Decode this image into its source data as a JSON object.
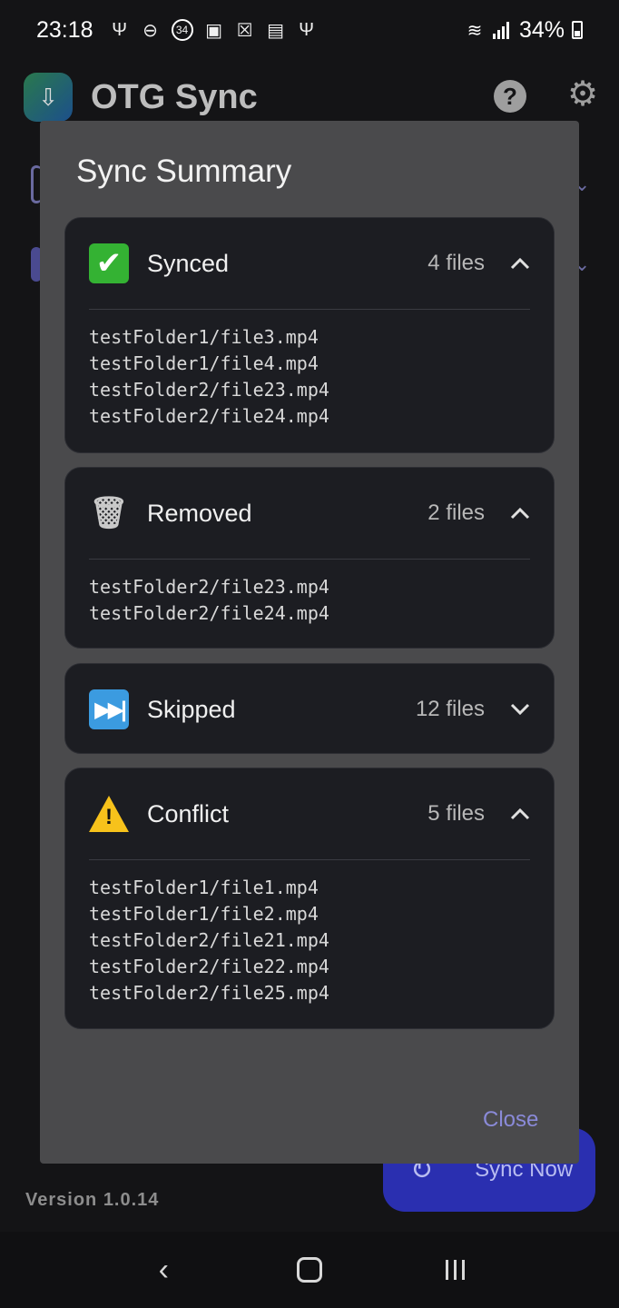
{
  "status_bar": {
    "time": "23:18",
    "battery": "34%",
    "icons": [
      "usb-icon",
      "dnd-icon",
      "notification-34-icon",
      "image-icon",
      "excel-icon",
      "calendar-icon",
      "usb-icon"
    ],
    "badge": "34"
  },
  "app": {
    "title": "OTG Sync",
    "version": "Version 1.0.14",
    "sync_now_label": "Sync Now"
  },
  "dialog": {
    "title": "Sync Summary",
    "close_label": "Close",
    "sections": [
      {
        "label": "Synced",
        "count": "4 files",
        "icon": "check-mark-icon",
        "expanded": true,
        "files": [
          "testFolder1/file3.mp4",
          "testFolder1/file4.mp4",
          "testFolder2/file23.mp4",
          "testFolder2/file24.mp4"
        ]
      },
      {
        "label": "Removed",
        "count": "2 files",
        "icon": "trash-icon",
        "expanded": true,
        "files": [
          "testFolder2/file23.mp4",
          "testFolder2/file24.mp4"
        ]
      },
      {
        "label": "Skipped",
        "count": "12 files",
        "icon": "fast-forward-icon",
        "expanded": false,
        "files": []
      },
      {
        "label": "Conflict",
        "count": "5 files",
        "icon": "warning-icon",
        "expanded": true,
        "files": [
          "testFolder1/file1.mp4",
          "testFolder1/file2.mp4",
          "testFolder2/file21.mp4",
          "testFolder2/file22.mp4",
          "testFolder2/file25.mp4"
        ]
      }
    ]
  },
  "colors": {
    "accent": "#8a8ad8",
    "sync_button": "#2a2fb0",
    "card_bg": "#1c1d22",
    "dialog_bg": "#4a4a4c"
  }
}
